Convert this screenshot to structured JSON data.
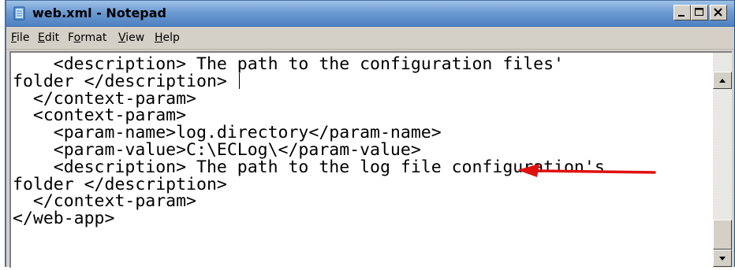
{
  "window": {
    "title": "web.xml - Notepad"
  },
  "menu": {
    "items": [
      {
        "accel": "F",
        "rest": "ile"
      },
      {
        "accel": "E",
        "rest": "dit"
      },
      {
        "pre": "F",
        "accel": "o",
        "rest": "rmat"
      },
      {
        "accel": "V",
        "rest": "iew"
      },
      {
        "accel": "H",
        "rest": "elp"
      }
    ]
  },
  "editor": {
    "line_1": "    <description> The path to the configuration files'",
    "line_2": "folder </description> ",
    "line_3": "  </context-param>",
    "line_4": "  <context-param>",
    "line_5": "    <param-name>log.directory</param-name>",
    "line_6": "    <param-value>C:\\ECLog\\</param-value>",
    "line_7": "    <description> The path to the log file configuration's",
    "line_8": "folder </description>",
    "line_9": "  </context-param>",
    "line_10": "</web-app>"
  },
  "colors": {
    "titlebar": "#6d9ad1",
    "annotation_arrow": "#e01010"
  },
  "icons": {
    "app": "notepad-icon",
    "minimize": "minimize-icon",
    "maximize": "maximize-icon",
    "close": "close-icon",
    "scroll_up": "arrow-up-icon",
    "scroll_down": "arrow-down-icon",
    "annotation": "red-arrow-icon"
  }
}
